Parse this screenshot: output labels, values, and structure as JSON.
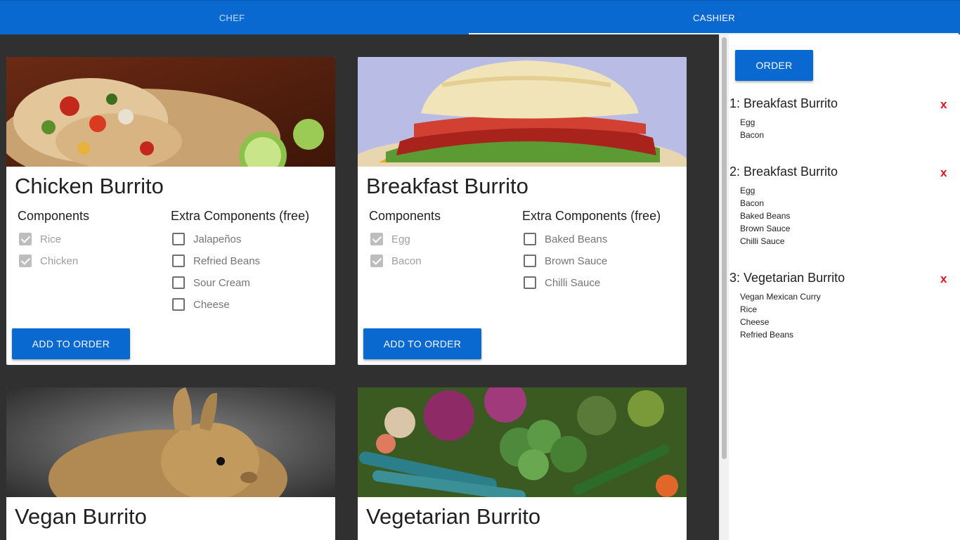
{
  "tabs": [
    {
      "label": "CHEF",
      "active": false
    },
    {
      "label": "CASHIER",
      "active": true
    }
  ],
  "colors": {
    "accent": "#0a68d1",
    "remove": "#e01414",
    "background": "#303030"
  },
  "menu": {
    "components_heading": "Components",
    "extras_heading": "Extra Components (free)",
    "add_label": "ADD TO ORDER",
    "cards": [
      {
        "title": "Chicken Burrito",
        "image": "burrito-photo",
        "components": [
          {
            "label": "Rice",
            "checked": true
          },
          {
            "label": "Chicken",
            "checked": true
          }
        ],
        "extras": [
          {
            "label": "Jalapeños",
            "checked": false
          },
          {
            "label": "Refried Beans",
            "checked": false
          },
          {
            "label": "Sour Cream",
            "checked": false
          },
          {
            "label": "Cheese",
            "checked": false
          }
        ]
      },
      {
        "title": "Breakfast Burrito",
        "image": "breakfast-sandwich-photo",
        "components": [
          {
            "label": "Egg",
            "checked": true
          },
          {
            "label": "Bacon",
            "checked": true
          }
        ],
        "extras": [
          {
            "label": "Baked Beans",
            "checked": false
          },
          {
            "label": "Brown Sauce",
            "checked": false
          },
          {
            "label": "Chilli Sauce",
            "checked": false
          }
        ]
      },
      {
        "title": "Vegan Burrito",
        "image": "rabbit-photo"
      },
      {
        "title": "Vegetarian Burrito",
        "image": "vegetables-photo"
      }
    ]
  },
  "order": {
    "button_label": "ORDER",
    "remove_label": "x",
    "items": [
      {
        "title": "1: Breakfast Burrito",
        "components": [
          "Egg",
          "Bacon"
        ]
      },
      {
        "title": "2: Breakfast Burrito",
        "components": [
          "Egg",
          "Bacon",
          "Baked Beans",
          "Brown Sauce",
          "Chilli Sauce"
        ]
      },
      {
        "title": "3: Vegetarian Burrito",
        "components": [
          "Vegan Mexican Curry",
          "Rice",
          "Cheese",
          "Refried Beans"
        ]
      }
    ]
  }
}
